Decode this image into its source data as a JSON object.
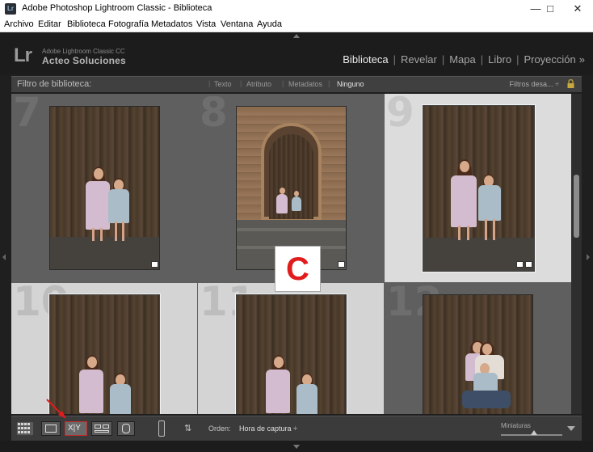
{
  "window": {
    "title": "Adobe Photoshop Lightroom Classic - Biblioteca",
    "app_icon": "Lr",
    "controls": [
      "minimize-icon",
      "maximize-icon",
      "close-icon"
    ]
  },
  "menu": [
    "Archivo",
    "Editar",
    "Biblioteca",
    "Fotografía",
    "Metadatos",
    "Vista",
    "Ventana",
    "Ayuda"
  ],
  "identity": {
    "logo": "Lr",
    "product": "Adobe Lightroom Classic CC",
    "plate": "Acteo Soluciones"
  },
  "modules": [
    "Biblioteca",
    "Revelar",
    "Mapa",
    "Libro",
    "Proyección"
  ],
  "modules_more": "»",
  "active_module": "Biblioteca",
  "filter_bar": {
    "label": "Filtro de biblioteca:",
    "tabs": [
      "Texto",
      "Atributo",
      "Metadatos",
      "Ninguno"
    ],
    "active_tab": "Ninguno",
    "presets": "Filtros desa... ÷"
  },
  "grid": {
    "cells": [
      {
        "number": "7",
        "selected": false
      },
      {
        "number": "8",
        "selected": false
      },
      {
        "number": "9",
        "selected": true
      },
      {
        "number": "10",
        "selected": true
      },
      {
        "number": "11",
        "selected": true
      },
      {
        "number": "12",
        "selected": false
      }
    ]
  },
  "toolbar": {
    "views": [
      "grid-view-icon",
      "loupe-view-icon",
      "compare-view-icon",
      "survey-view-icon",
      "people-view-icon"
    ],
    "compare_label": "X|Y",
    "sort_label": "Orden:",
    "sort_value": "Hora de captura ÷",
    "thumb_label": "Miniaturas",
    "thumbnail_size": 0.5
  },
  "annotation": {
    "letter": "C",
    "color": "#e11c1c"
  },
  "colors": {
    "accent": "#e11c1c",
    "selected_cell": "#d4d4d4",
    "unselected_cell": "#6a6a6a"
  }
}
